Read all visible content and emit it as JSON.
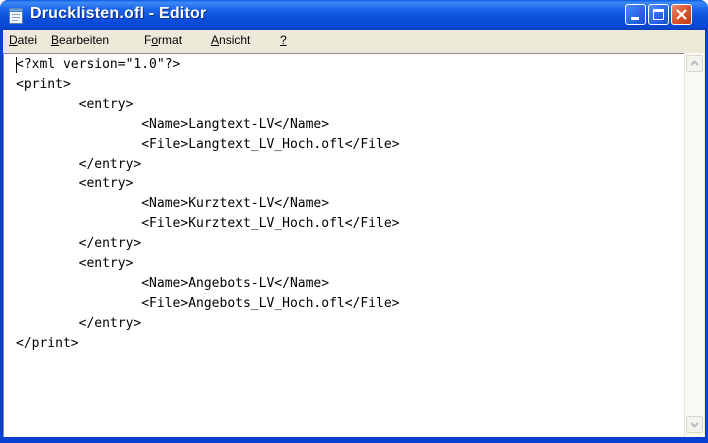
{
  "window": {
    "title": "Drucklisten.ofl - Editor",
    "accent_color": "#0841d2",
    "icon": "notepad-icon"
  },
  "title_buttons": {
    "minimize_icon": "minimize-icon",
    "maximize_icon": "maximize-icon",
    "close_icon": "close-icon"
  },
  "menu": {
    "datei": {
      "accel": "D",
      "rest": "atei"
    },
    "bearbeiten": {
      "accel": "B",
      "rest": "earbeiten"
    },
    "format": {
      "pre": "F",
      "accel": "o",
      "rest": "rmat"
    },
    "ansicht": {
      "accel": "A",
      "rest": "nsicht"
    },
    "help": {
      "accel": "?"
    }
  },
  "editor": {
    "content": "<?xml version=\"1.0\"?>\n<print>\n\t<entry>\n\t\t<Name>Langtext-LV</Name>\n\t\t<File>Langtext_LV_Hoch.ofl</File>\n\t</entry>\n\t<entry>\n\t\t<Name>Kurztext-LV</Name>\n\t\t<File>Kurztext_LV_Hoch.ofl</File>\n\t</entry>\n\t<entry>\n\t\t<Name>Angebots-LV</Name>\n\t\t<File>Angebots_LV_Hoch.ofl</File>\n\t</entry>\n</print>"
  },
  "scrollbar": {
    "up_icon": "arrow-up-icon",
    "down_icon": "arrow-down-icon"
  }
}
